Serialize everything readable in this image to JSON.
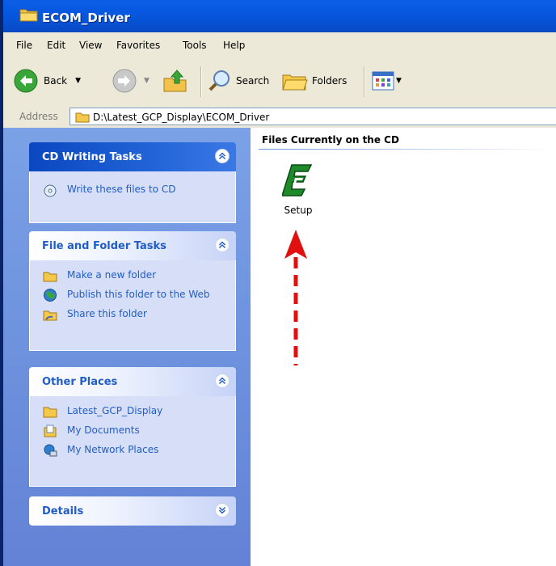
{
  "window": {
    "title": "ECOM_Driver"
  },
  "menu": {
    "items": [
      "File",
      "Edit",
      "View",
      "Favorites",
      "Tools",
      "Help"
    ]
  },
  "toolbar": {
    "back_label": "Back",
    "search_label": "Search",
    "folders_label": "Folders"
  },
  "address": {
    "label": "Address",
    "path": "D:\\Latest_GCP_Display\\ECOM_Driver"
  },
  "taskpane": {
    "cd_writing": {
      "title": "CD Writing Tasks",
      "items": [
        "Write these files to CD"
      ]
    },
    "file_folder": {
      "title": "File and Folder Tasks",
      "items": [
        "Make a new folder",
        "Publish this folder to the Web",
        "Share this folder"
      ]
    },
    "other_places": {
      "title": "Other Places",
      "items": [
        "Latest_GCP_Display",
        "My Documents",
        "My Network Places"
      ]
    },
    "details": {
      "title": "Details"
    }
  },
  "content": {
    "group_title": "Files Currently on the CD",
    "files": [
      {
        "name": "Setup",
        "icon": "setup-app-icon"
      }
    ]
  },
  "colors": {
    "titlebar": "#0554d8",
    "link": "#215dc6",
    "annotation_arrow": "#e01010"
  }
}
